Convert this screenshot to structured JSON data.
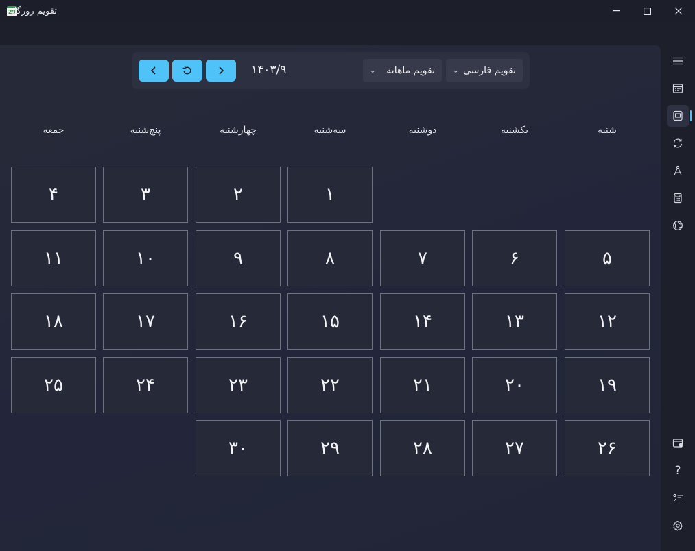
{
  "window": {
    "title": "تقویم روزگار",
    "app_icon_text": "29",
    "minimize": "—",
    "maximize": "☐",
    "close": "✕"
  },
  "toolbar": {
    "date": "۱۴۰۳/۹",
    "calendar_system": "تقویم فارسی",
    "view_mode": "تقویم ماهانه",
    "accent_color": "#4fc3f7"
  },
  "weekdays": [
    "شنبه",
    "یکشنبه",
    "دوشنبه",
    "سه‌شنبه",
    "چهارشنبه",
    "پنج‌شنبه",
    "جمعه"
  ],
  "month_start_column": 3,
  "days": [
    "۱",
    "۲",
    "۳",
    "۴",
    "۵",
    "۶",
    "۷",
    "۸",
    "۹",
    "۱۰",
    "۱۱",
    "۱۲",
    "۱۳",
    "۱۴",
    "۱۵",
    "۱۶",
    "۱۷",
    "۱۸",
    "۱۹",
    "۲۰",
    "۲۱",
    "۲۲",
    "۲۳",
    "۲۴",
    "۲۵",
    "۲۶",
    "۲۷",
    "۲۸",
    "۲۹",
    "۳۰"
  ],
  "sidebar": {
    "top": [
      "menu-icon",
      "calendar-icon",
      "month-view-icon",
      "converter-icon",
      "compass-icon",
      "calculator-icon",
      "globe-icon"
    ],
    "bottom": [
      "privacy-icon",
      "help-icon",
      "list-icon",
      "settings-icon"
    ],
    "help_glyph": "?"
  }
}
